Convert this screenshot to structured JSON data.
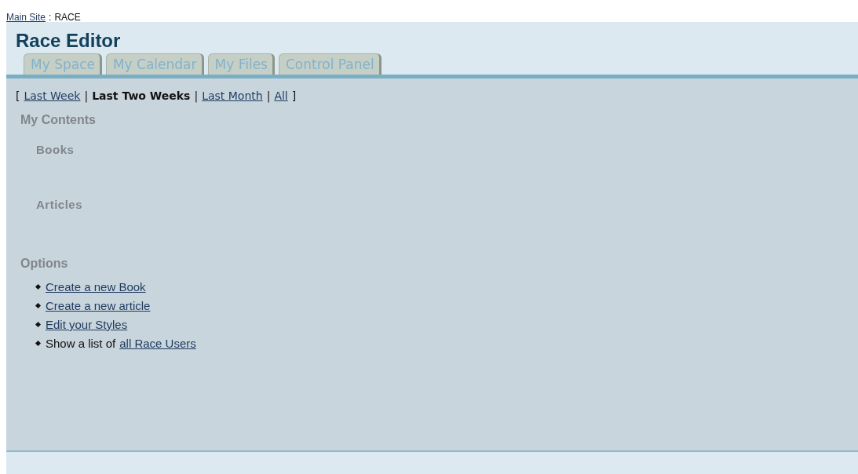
{
  "breadcrumb": {
    "link": "Main Site",
    "separator": ":",
    "current": "RACE"
  },
  "title": "Race Editor",
  "tabs": [
    {
      "label": "My Space",
      "selected": false
    },
    {
      "label": "My Calendar",
      "selected": false
    },
    {
      "label": "My Files",
      "selected": false
    },
    {
      "label": "Control Panel",
      "selected": false
    }
  ],
  "filters": {
    "open": "[",
    "close": "]",
    "separator": "|",
    "items": [
      {
        "label": "Last Week",
        "selected": false
      },
      {
        "label": "Last Two Weeks",
        "selected": true
      },
      {
        "label": "Last Month",
        "selected": false
      },
      {
        "label": "All",
        "selected": false
      }
    ]
  },
  "contents": {
    "heading": "My Contents",
    "sections": [
      "Books",
      "Articles"
    ]
  },
  "options": {
    "heading": "Options",
    "items": [
      {
        "kind": "link",
        "link": "Create a new Book"
      },
      {
        "kind": "link",
        "link": "Create a new article"
      },
      {
        "kind": "link",
        "link": "Edit your Styles"
      },
      {
        "kind": "text-link",
        "text": "Show a list of",
        "link": "all Race Users"
      }
    ]
  }
}
